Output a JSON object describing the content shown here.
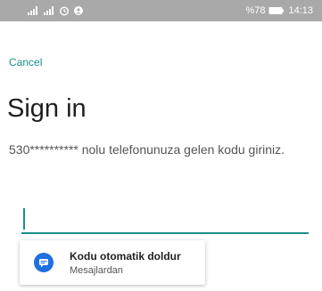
{
  "status_bar": {
    "icons": [
      "signal-icon",
      "signal-icon",
      "alarm-icon",
      "location-icon",
      "battery-icon"
    ],
    "battery": "%78",
    "time": "14:13"
  },
  "header": {
    "cancel_label": "Cancel"
  },
  "main": {
    "title": "Sign in",
    "phone_prefix": "530",
    "phone_mask": "**********",
    "instruction_rest": "  nolu telefonunuza gelen kodu giriniz.",
    "code_input": {
      "value": "",
      "placeholder": ""
    }
  },
  "autofill": {
    "icon": "message-icon",
    "title": "Kodu otomatik doldur",
    "subtitle": "Mesajlardan"
  },
  "colors": {
    "accent": "#1a8f88",
    "status_bar": "#a9a9a9",
    "autofill_icon": "#1e6fe0"
  }
}
